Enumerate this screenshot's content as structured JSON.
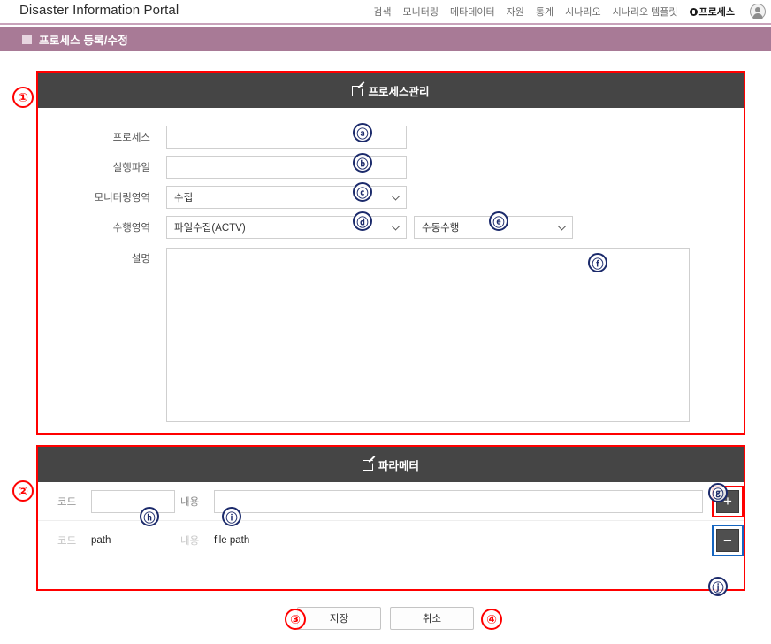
{
  "header": {
    "brand": "Disaster Information Portal",
    "nav": [
      {
        "label": "검색",
        "active": false
      },
      {
        "label": "모니터링",
        "active": false
      },
      {
        "label": "메타데이터",
        "active": false
      },
      {
        "label": "자원",
        "active": false
      },
      {
        "label": "통계",
        "active": false
      },
      {
        "label": "시나리오",
        "active": false
      },
      {
        "label": "시나리오 템플릿",
        "active": false
      },
      {
        "label": "프로세스",
        "active": true
      }
    ],
    "avatar_icon": "user-avatar-icon"
  },
  "page_title_bar": {
    "icon": "square-icon",
    "title": "프로세스 등록/수정",
    "background_color": "#a87a96"
  },
  "panel_process": {
    "header_icon": "edit-pencil-icon",
    "header_title": "프로세스관리",
    "header_bg": "#454545",
    "fields": {
      "process_label": "프로세스",
      "process_value": "",
      "exec_file_label": "실행파일",
      "exec_file_value": "",
      "monitoring_area_label": "모니터링영역",
      "monitoring_area_value": "수집",
      "exec_area_label": "수행영역",
      "exec_area_value": "파일수집(ACTV)",
      "exec_mode_value": "수동수행",
      "description_label": "설명",
      "description_value": ""
    }
  },
  "panel_parameter": {
    "header_icon": "edit-pencil-icon",
    "header_title": "파라메터",
    "header_bg": "#454545",
    "column_code_label": "코드",
    "column_content_label": "내용",
    "add_button_label": "+",
    "remove_button_label": "−",
    "rows": [
      {
        "code": "",
        "content": "",
        "editable": true
      },
      {
        "code": "path",
        "content": "file path",
        "editable": false
      }
    ]
  },
  "footer": {
    "save_label": "저장",
    "cancel_label": "취소"
  },
  "annotations": {
    "one": "①",
    "two": "②",
    "three": "③",
    "four": "④",
    "a": "ⓐ",
    "b": "ⓑ",
    "c": "ⓒ",
    "d": "ⓓ",
    "e": "ⓔ",
    "f": "ⓕ",
    "g": "ⓖ",
    "h": "ⓗ",
    "i": "ⓘ",
    "j": "ⓙ",
    "marker_blue_color": "#1b2a6b",
    "marker_red_color": "#ff0000"
  }
}
